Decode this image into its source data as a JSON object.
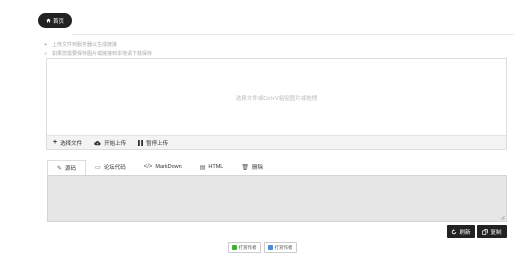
{
  "nav": {
    "home_label": "首页"
  },
  "tips": [
    {
      "mark": "+",
      "text": "上传文件到服务器以生成链接"
    },
    {
      "mark": "○",
      "text": "如果您需要保存图片或链接到本地请下载保存"
    }
  ],
  "upload": {
    "drop_hint": "选择文件或Ctrl+V粘贴图片或拖拽",
    "toolbar": {
      "select_label": "选择文件",
      "start_label": "开始上传",
      "pause_label": "暂停上传"
    }
  },
  "tabs": [
    {
      "icon": "link-icon",
      "glyph": "✎",
      "label": "源码"
    },
    {
      "icon": "comment-icon",
      "glyph": "▭",
      "label": "论坛代码"
    },
    {
      "icon": "code-icon",
      "glyph": "</>",
      "label": "MarkDown"
    },
    {
      "icon": "file-icon",
      "glyph": "▤",
      "label": "HTML"
    },
    {
      "icon": "trash-icon",
      "glyph": "🗑",
      "label": "删除"
    }
  ],
  "output": {
    "value": ""
  },
  "actions": {
    "refresh_label": "刷新",
    "copy_label": "复制"
  },
  "donate": [
    {
      "label": "打赏作者",
      "color": "#3cb034"
    },
    {
      "label": "打赏作者",
      "color": "#4a8bd8"
    }
  ],
  "colors": {
    "dark": "#222222",
    "textarea_bg": "#e6e6e6",
    "toolbar_bg": "#f3f3f3"
  }
}
